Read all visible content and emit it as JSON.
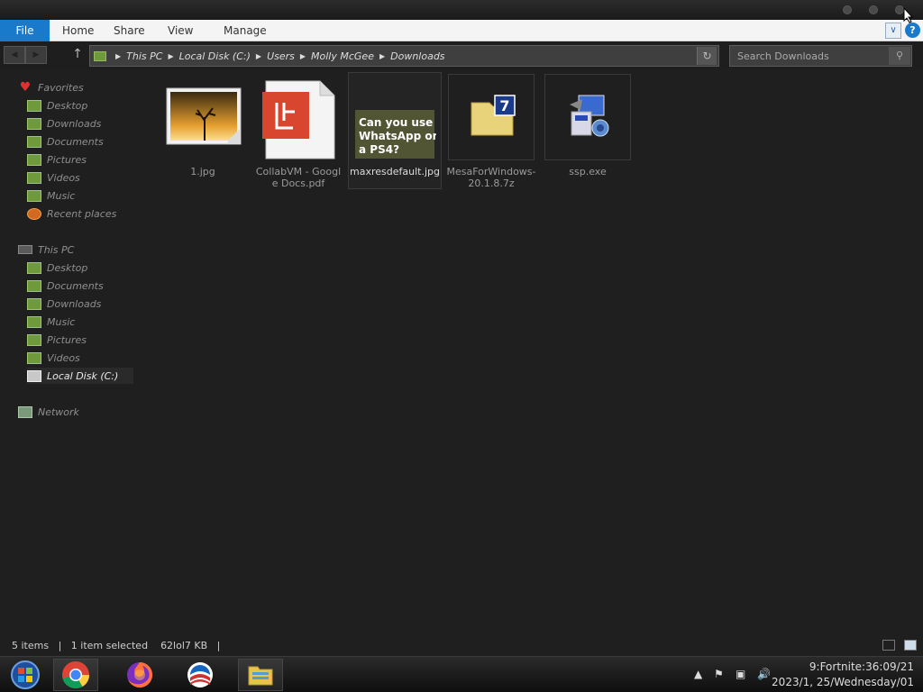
{
  "ribbon": {
    "tabs": [
      "File",
      "Home",
      "Share",
      "View",
      "Manage"
    ],
    "help_label": "?"
  },
  "address": {
    "crumbs": [
      "This PC",
      "Local Disk (C:)",
      "Users",
      "Molly McGee",
      "Downloads"
    ]
  },
  "search": {
    "placeholder": "Search Downloads"
  },
  "sidebar": {
    "favorites": {
      "label": "Favorites",
      "items": [
        "Desktop",
        "Downloads",
        "Documents",
        "Pictures",
        "Videos",
        "Music",
        "Recent places"
      ]
    },
    "this_pc": {
      "label": "This PC",
      "items": [
        "Desktop",
        "Documents",
        "Downloads",
        "Music",
        "Pictures",
        "Videos",
        "Local Disk (C:)"
      ]
    },
    "network": {
      "label": "Network"
    }
  },
  "files": [
    {
      "name": "1.jpg",
      "type": "image"
    },
    {
      "name": "CollabVM - Google Docs.pdf",
      "type": "pdf"
    },
    {
      "name": "maxresdefault.jpg",
      "type": "image-thumb",
      "thumb_text": "Can you use WhatsApp on a PS4?",
      "selected": true
    },
    {
      "name": "MesaForWindows-20.1.8.7z",
      "type": "archive"
    },
    {
      "name": "ssp.exe",
      "type": "exe"
    }
  ],
  "status": {
    "items": "5 items",
    "selected": "1 item selected",
    "size": "62lol7 KB"
  },
  "taskbar": {
    "apps": [
      "start-icon",
      "chrome-icon",
      "firefox-icon",
      "campaign-logo-icon",
      "file-explorer-icon"
    ],
    "clock_line1": "9:Fortnite:36:09/21",
    "clock_line2": "2023/1, 25/Wednesday/01"
  },
  "colors": {
    "accent": "#1979ca",
    "background": "#1f1f1f",
    "folder_green": "#6e9a3b"
  }
}
